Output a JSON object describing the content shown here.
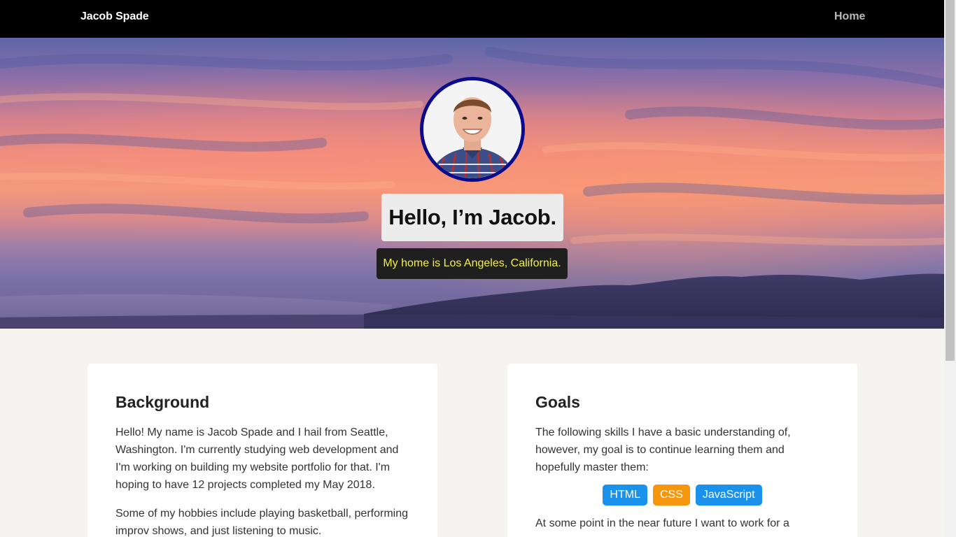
{
  "navbar": {
    "brand": "Jacob Spade",
    "home_label": "Home"
  },
  "hero": {
    "title": "Hello, I’m Jacob.",
    "subtitle": "My home is Los Angeles, California.",
    "avatar_alt": "profile photo"
  },
  "background_card": {
    "heading": "Background",
    "paragraphs": [
      "Hello! My name is Jacob Spade and I hail from Seattle, Washington. I'm currently studying web development and I'm working on building my website portfolio for that. I'm hoping to have 12 projects completed my May 2018.",
      "Some of my hobbies include playing basketball, performing improv shows, and just listening to music."
    ]
  },
  "goals_card": {
    "heading": "Goals",
    "intro": "The following skills I have a basic understanding of, however, my goal is to continue learning them and hopefully master them:",
    "skills": [
      {
        "label": "HTML",
        "color": "#1a91ea"
      },
      {
        "label": "CSS",
        "color": "#f5960c"
      },
      {
        "label": "JavaScript",
        "color": "#1a91ea"
      }
    ],
    "outro": "At some point in the near future I want to work for a"
  },
  "colors": {
    "navbar_bg": "#000000",
    "avatar_border": "#0b0c8c",
    "subtitle_text": "#f3f141",
    "page_bg": "#f5f4f0"
  }
}
